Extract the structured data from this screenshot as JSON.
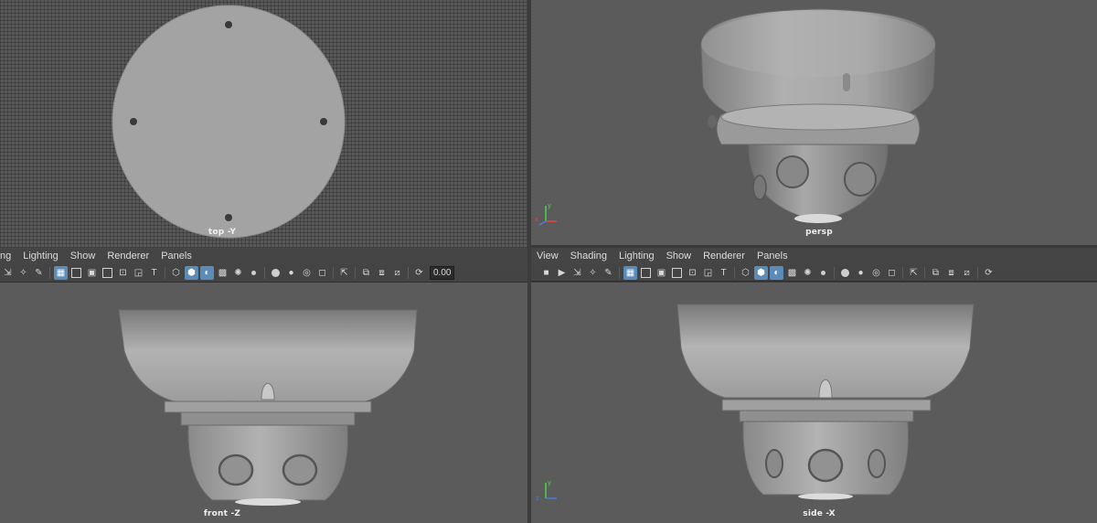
{
  "viewports": {
    "top": {
      "label": "top -Y"
    },
    "persp": {
      "label": "persp"
    },
    "front": {
      "label": "front -Z"
    },
    "side": {
      "label": "side -X"
    }
  },
  "left_panel": {
    "menu": [
      "ng",
      "Lighting",
      "Show",
      "Renderer",
      "Panels"
    ],
    "field_value": "0.00"
  },
  "right_panel": {
    "menu": [
      "View",
      "Shading",
      "Lighting",
      "Show",
      "Renderer",
      "Panels"
    ]
  },
  "gizmo": {
    "x": "x",
    "y": "y",
    "z": "z"
  },
  "colors": {
    "viewport_bg": "#5b5b5b",
    "model_fill": "#a2a2a2",
    "highlight": "#5b8cb8"
  }
}
